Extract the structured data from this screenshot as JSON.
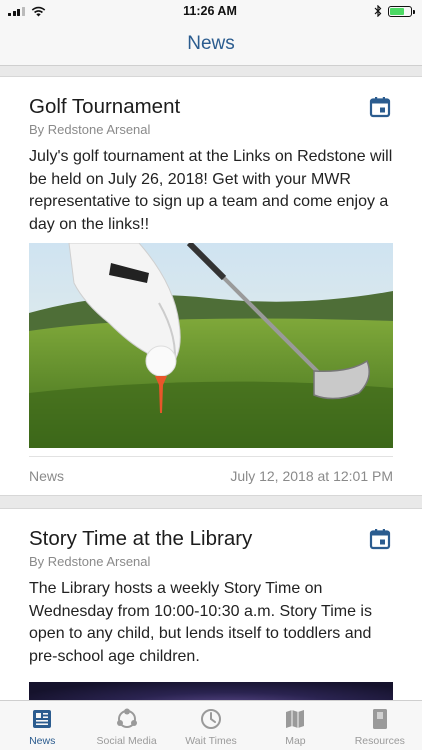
{
  "status": {
    "time": "11:26 AM",
    "battery_level": 0.7
  },
  "nav": {
    "title": "News"
  },
  "cards": [
    {
      "title": "Golf Tournament",
      "author": "By Redstone Arsenal",
      "body": "July's golf tournament at the Links on Redstone will be held on July 26, 2018! Get with your MWR representative to sign up a team and come enjoy a day on the links!!",
      "image": "golf-ball-tee-photo",
      "category": "News",
      "date": "July 12, 2018 at 12:01 PM"
    },
    {
      "title": "Story Time at the Library",
      "author": "By Redstone Arsenal",
      "body": "The Library hosts a weekly Story Time on Wednesday from 10:00-10:30 a.m. Story Time is open to any child, but lends itself to toddlers and pre-school age children.",
      "image": "starry-sky-photo"
    }
  ],
  "tabs": [
    {
      "label": "News",
      "icon": "newspaper-icon",
      "active": true
    },
    {
      "label": "Social Media",
      "icon": "social-media-icon",
      "active": false
    },
    {
      "label": "Wait Times",
      "icon": "clock-icon",
      "active": false
    },
    {
      "label": "Map",
      "icon": "map-icon",
      "active": false
    },
    {
      "label": "Resources",
      "icon": "book-icon",
      "active": false
    }
  ],
  "colors": {
    "accent": "#2b5c8f",
    "inactive": "#9a9a9a",
    "battery": "#4cd964"
  }
}
